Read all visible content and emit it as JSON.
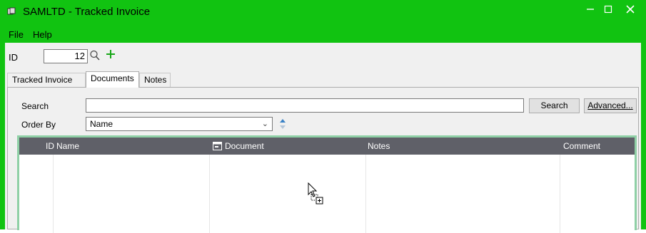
{
  "window": {
    "title": "SAMLTD - Tracked Invoice",
    "controls": [
      "minimize",
      "maximize",
      "close"
    ]
  },
  "menu": {
    "file": "File",
    "help": "Help"
  },
  "record": {
    "id_label": "ID",
    "id_value": "12"
  },
  "tabs": [
    {
      "label": "Tracked Invoice",
      "active": false
    },
    {
      "label": "Documents",
      "active": true
    },
    {
      "label": "Notes",
      "active": false
    }
  ],
  "search": {
    "label": "Search",
    "value": "",
    "button": "Search",
    "advanced_button": "Advanced..."
  },
  "order_by": {
    "label": "Order By",
    "value": "Name"
  },
  "grid": {
    "columns": [
      "ID",
      "Name",
      "Document",
      "Notes",
      "Comment"
    ],
    "rows": []
  },
  "colors": {
    "accent": "#11c311",
    "grid_header": "#5f6068",
    "grid_border": "#8fd0a6"
  }
}
